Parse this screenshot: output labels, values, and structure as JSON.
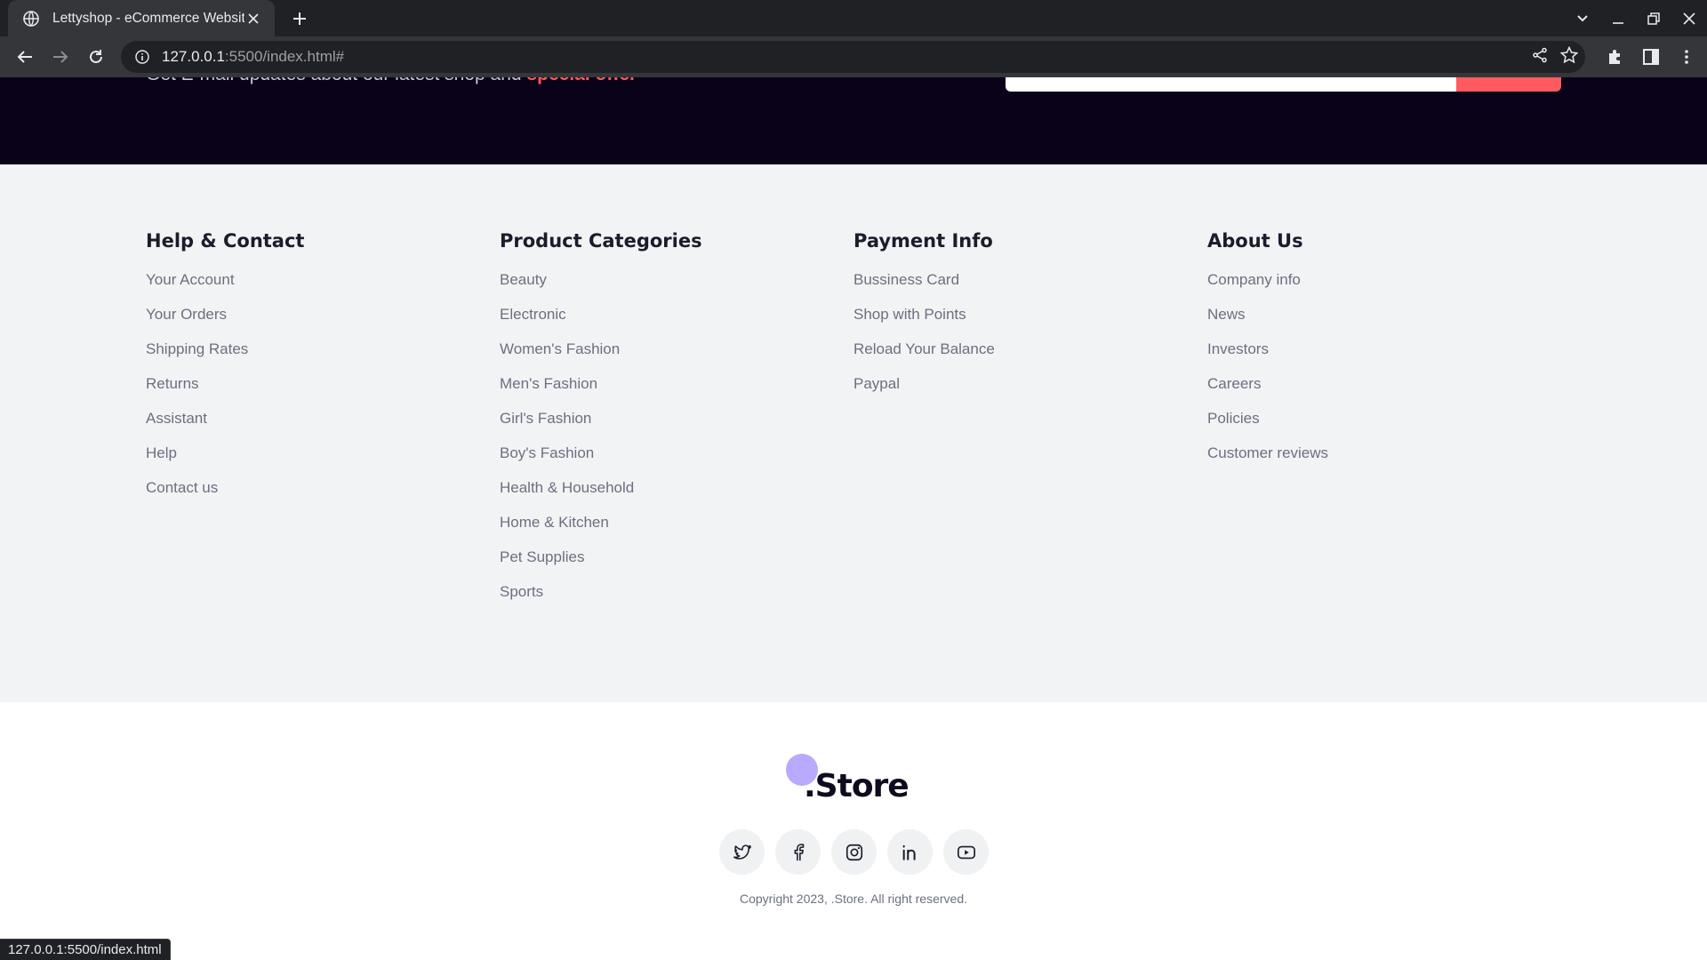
{
  "browser": {
    "tab_title": "Lettyshop - eCommerce Website",
    "url_host": "127.0.0.1",
    "url_rest": ":5500/index.html#",
    "status_url": "127.0.0.1:5500/index.html"
  },
  "newsletter": {
    "text": "Get E-mail updates about our latest shop and",
    "highlight": "special offer"
  },
  "footer": {
    "columns": [
      {
        "heading": "Help & Contact",
        "links": [
          "Your Account",
          "Your Orders",
          "Shipping Rates",
          "Returns",
          "Assistant",
          "Help",
          "Contact us"
        ]
      },
      {
        "heading": "Product Categories",
        "links": [
          "Beauty",
          "Electronic",
          "Women's Fashion",
          "Men's Fashion",
          "Girl's Fashion",
          "Boy's Fashion",
          "Health & Household",
          "Home & Kitchen",
          "Pet Supplies",
          "Sports"
        ]
      },
      {
        "heading": "Payment Info",
        "links": [
          "Bussiness Card",
          "Shop with Points",
          "Reload Your Balance",
          "Paypal"
        ]
      },
      {
        "heading": "About Us",
        "links": [
          "Company info",
          "News",
          "Investors",
          "Careers",
          "Policies",
          "Customer reviews"
        ]
      }
    ],
    "logo_text": ".Store",
    "socials": [
      "twitter-icon",
      "facebook-icon",
      "instagram-icon",
      "linkedin-icon",
      "youtube-icon"
    ],
    "copyright": "Copyright 2023, .Store. All right reserved."
  },
  "colors": {
    "newsletter_bg": "#0a0219",
    "accent": "#ff5a5f",
    "logo_dot": "#b9a9ff",
    "links_bg": "#f2f3f5"
  }
}
